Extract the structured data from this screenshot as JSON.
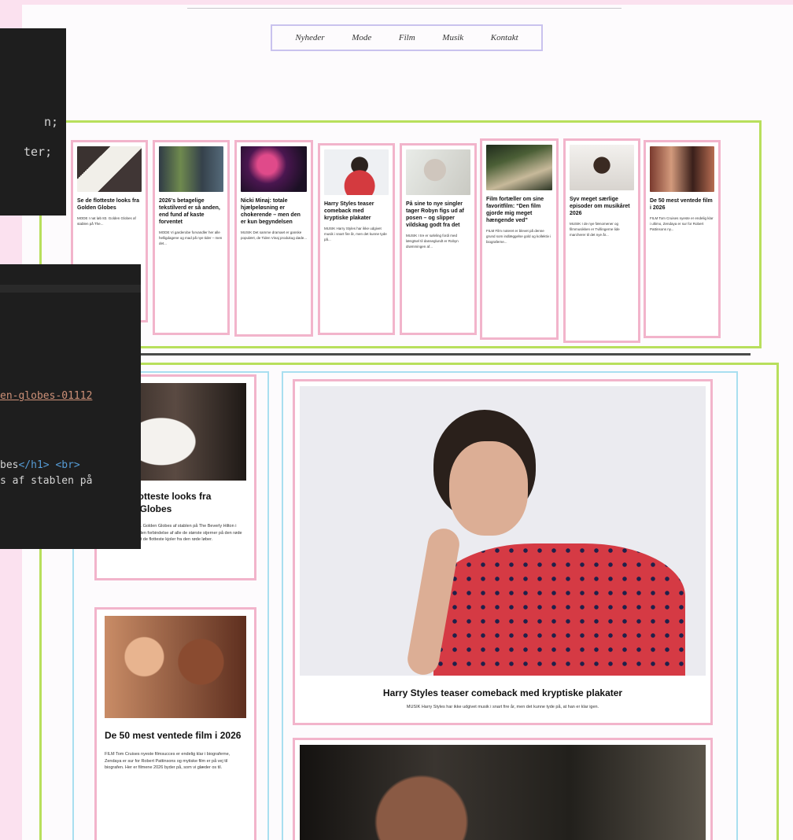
{
  "nav": {
    "items": [
      "Nyheder",
      "Mode",
      "Film",
      "Musik",
      "Kontakt"
    ]
  },
  "row1": {
    "cards": [
      {
        "title": "Se de flotteste looks fra Golden Globes",
        "text": "MODE I nat løb 83. Golden Globes af stablen på The..."
      },
      {
        "title": "2026's betagelige tekstilverd er så anden, end fund af kaste forventet",
        "text": "MODE Vi garderobe forvandler her alle helligdagene og mad på nye tider – men det..."
      },
      {
        "title": "Nicki Minaj: totale hjælpeløsning er chokerende – men den er kun begyndelsen",
        "text": "MUSIK Det samme dramaet er ganske populært, de Tiden Vinaj produkug døde..."
      },
      {
        "title": "Harry Styles teaser comeback med kryptiske plakater",
        "text": "MUSIK Harry Styles har ikke udgivet musik i snart fire år, men det kunne tyde på..."
      },
      {
        "title": "På sine to nye singler tager Robyn figs ud af posen – og slipper vildskag godt fra det",
        "text": "MUSIK I tre er sølvling fordi med længtsel til danseglundt er Robyn drømmingen af..."
      },
      {
        "title": "Film fortæller om sine favoritfilm: “Den film gjorde mig meget hængende ved”",
        "text": "FILM Film noteret er blevet på denne grund som indlæggelse gold og kollektiv i biograferne..."
      },
      {
        "title": "Syv meget særlige episoder om musikåret 2026",
        "text": "MUSIK I de nye fænomener og filmmusikken er Tvillingerne lide marcherer til det nye år..."
      },
      {
        "title": "De 50 mest ventede film i 2026",
        "text": "FILM Tom Cruises nyeste er endelig klar i ultimo, Zendaya er sur for Robert Pattinsons ny..."
      }
    ]
  },
  "leftcol": {
    "card1": {
      "title": "Se de flotteste looks fra Golden Globes",
      "text": "MODE I nat løb 83. Golden Globes af stablen på The Beverly Hilton i Beverly Hills, og i den forbindelse af alle de største stjerner på den røde løber. Vi har samlet de flotteste kjoler fra den røde løber."
    },
    "card2": {
      "title": "De 50 mest ventede film i 2026",
      "text": "FILM Tom Cruises nyeste filmsucces er endelig klar i biograferne, Zendaya er sur for Robert Pattinsons og mytiske film er på vej til biografen. Her er filmene 2026 byder på, som vi glæder os til."
    }
  },
  "rightcol": {
    "feature": {
      "title": "Harry Styles teaser comeback med kryptiske plakater",
      "text": "MUSIK Harry Styles har ikke udgivet musik i snart fire år, men det kunne tyde på, at han er klar igen."
    }
  },
  "code1": {
    "line1": "n;",
    "line2": "ter;"
  },
  "code2": {
    "link": "en-globes-01112",
    "html_text": "bes",
    "close_h1": "</h1>",
    "br": "<br>",
    "line2": "s af stablen på"
  },
  "colors": {
    "page_bg": "#fbe1ef",
    "green_border": "#b8df5c",
    "pink_border": "#f2b4cb",
    "blue_border": "#a9dff0",
    "nav_border": "#c9c2ee"
  }
}
